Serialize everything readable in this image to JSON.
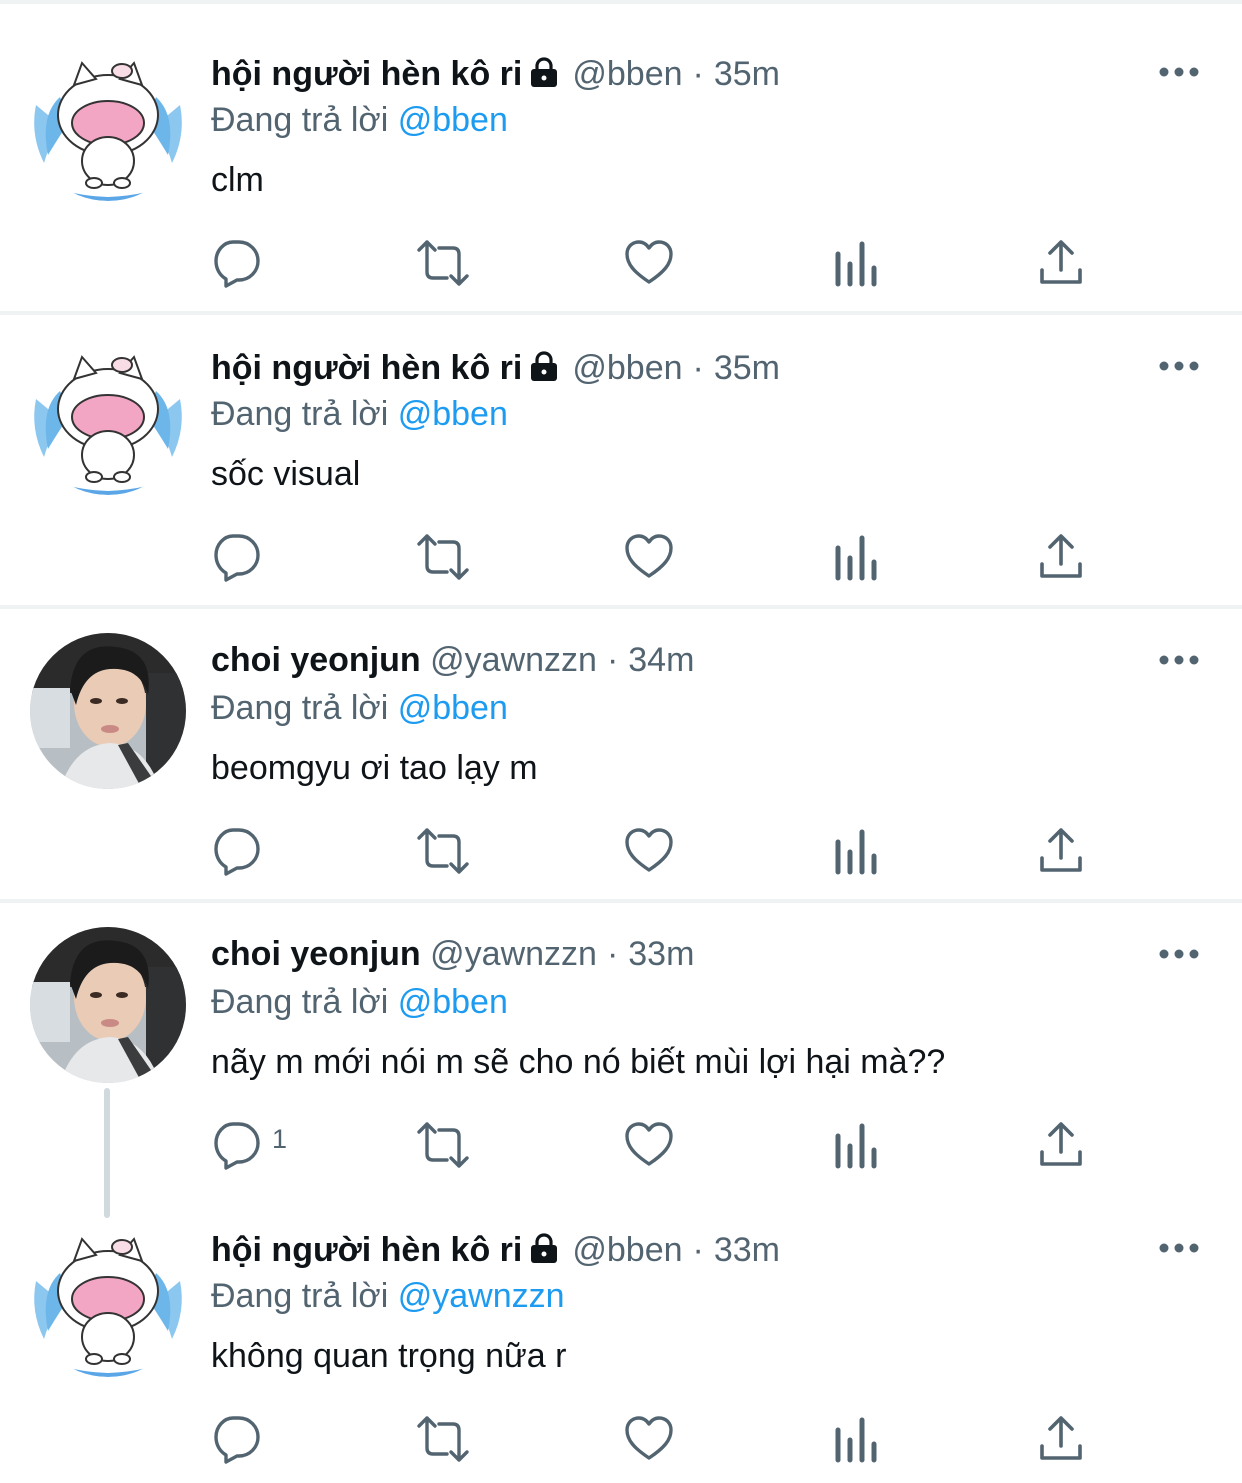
{
  "colors": {
    "text": "#0f1419",
    "secondary": "#536471",
    "accent": "#1d9bf0",
    "divider": "#eff3f4"
  },
  "tweets": [
    {
      "name": "hội người hèn kô ri",
      "handle": "@bben",
      "separator": "·",
      "time": "35m",
      "reply_prefix": "Đang trả lời",
      "reply_to": "@bben",
      "text": "clm",
      "protected": true,
      "avatar": "crying-cat-avatar",
      "reply_count": ""
    },
    {
      "name": "hội người hèn kô ri",
      "handle": "@bben",
      "separator": "·",
      "time": "35m",
      "reply_prefix": "Đang trả lời",
      "reply_to": "@bben",
      "text": "sốc visual",
      "protected": true,
      "avatar": "crying-cat-avatar",
      "reply_count": ""
    },
    {
      "name": "choi yeonjun",
      "handle": "@yawnzzn",
      "separator": "·",
      "time": "34m",
      "reply_prefix": "Đang trả lời",
      "reply_to": "@bben",
      "text": "beomgyu ơi tao lạy m",
      "protected": false,
      "avatar": "profile-photo-avatar",
      "reply_count": ""
    },
    {
      "name": "choi yeonjun",
      "handle": "@yawnzzn",
      "separator": "·",
      "time": "33m",
      "reply_prefix": "Đang trả lời",
      "reply_to": "@bben",
      "text": "nãy m mới nói m sẽ cho nó biết mùi lợi hại mà??",
      "protected": false,
      "avatar": "profile-photo-avatar",
      "reply_count": "1"
    },
    {
      "name": "hội người hèn kô ri",
      "handle": "@bben",
      "separator": "·",
      "time": "33m",
      "reply_prefix": "Đang trả lời",
      "reply_to": "@yawnzzn",
      "text": "không quan trọng nữa r",
      "protected": true,
      "avatar": "crying-cat-avatar",
      "reply_count": ""
    }
  ],
  "icons": [
    "reply-icon",
    "retweet-icon",
    "like-icon",
    "views-icon",
    "share-icon",
    "more-icon",
    "lock-icon"
  ]
}
